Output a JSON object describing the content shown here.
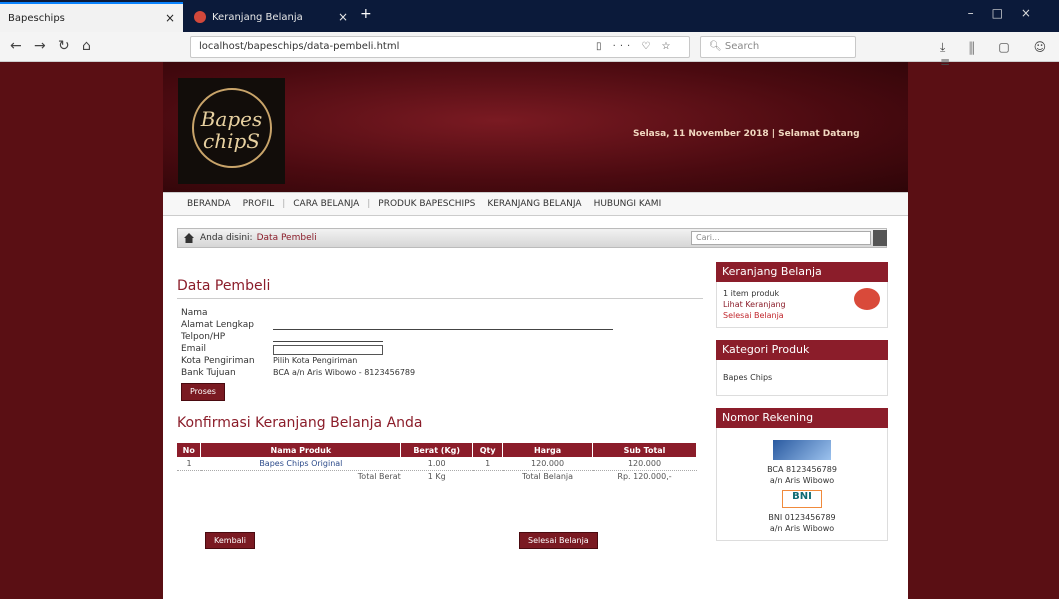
{
  "browser": {
    "active_tab": "Bapeschips",
    "inactive_tab": "Keranjang Belanja",
    "url": "localhost/bapeschips/data-pembeli.html",
    "search_placeholder": "Search"
  },
  "header": {
    "logo_line1": "Bapes",
    "logo_line2": "chipS",
    "date_text": "Selasa, 11 November 2018 | Selamat Datang"
  },
  "menu": {
    "items": [
      "BERANDA",
      "PROFIL",
      "CARA BELANJA",
      "PRODUK BAPESCHIPS",
      "KERANJANG BELANJA",
      "HUBUNGI KAMI"
    ]
  },
  "breadcrumb": {
    "prefix": "Anda disini:",
    "current": "Data Pembeli",
    "search_placeholder": "Cari..."
  },
  "form": {
    "title": "Data Pembeli",
    "labels": [
      "Nama",
      "Alamat Lengkap",
      "Telpon/HP",
      "Email",
      "Kota Pengiriman",
      "Bank Tujuan"
    ],
    "kota_value": "Pilih Kota Pengiriman",
    "bank_value": "BCA a/n Aris Wibowo - 8123456789",
    "submit": "Proses"
  },
  "cart": {
    "title": "Konfirmasi Keranjang Belanja Anda",
    "headers": [
      "No",
      "Nama Produk",
      "Berat (Kg)",
      "Qty",
      "Harga",
      "Sub Total"
    ],
    "rows": [
      {
        "no": "1",
        "produk": "Bapes Chips Original",
        "berat": "1.00",
        "qty": "1",
        "harga": "120.000",
        "subtotal": "120.000"
      }
    ],
    "total_berat_label": "Total Berat",
    "total_berat_value": "1 Kg",
    "total_belanja_label": "Total Belanja",
    "total_belanja_value": "Rp. 120.000,-",
    "back_button": "Kembali",
    "checkout_button": "Selesai Belanja"
  },
  "sidebar": {
    "keranjang_title": "Keranjang Belanja",
    "keranjang_items": [
      "1 item produk",
      "Lihat Keranjang",
      "Selesai Belanja"
    ],
    "kategori_title": "Kategori Produk",
    "kategori_items": [
      "Bapes Chips"
    ],
    "rekening_title": "Nomor Rekening",
    "bank1_text": "BCA 8123456789",
    "bank1_owner": "a/n Aris Wibowo",
    "bank2_logo": "BNI",
    "bank2_text": "BNI 0123456789",
    "bank2_owner": "a/n Aris Wibowo"
  }
}
